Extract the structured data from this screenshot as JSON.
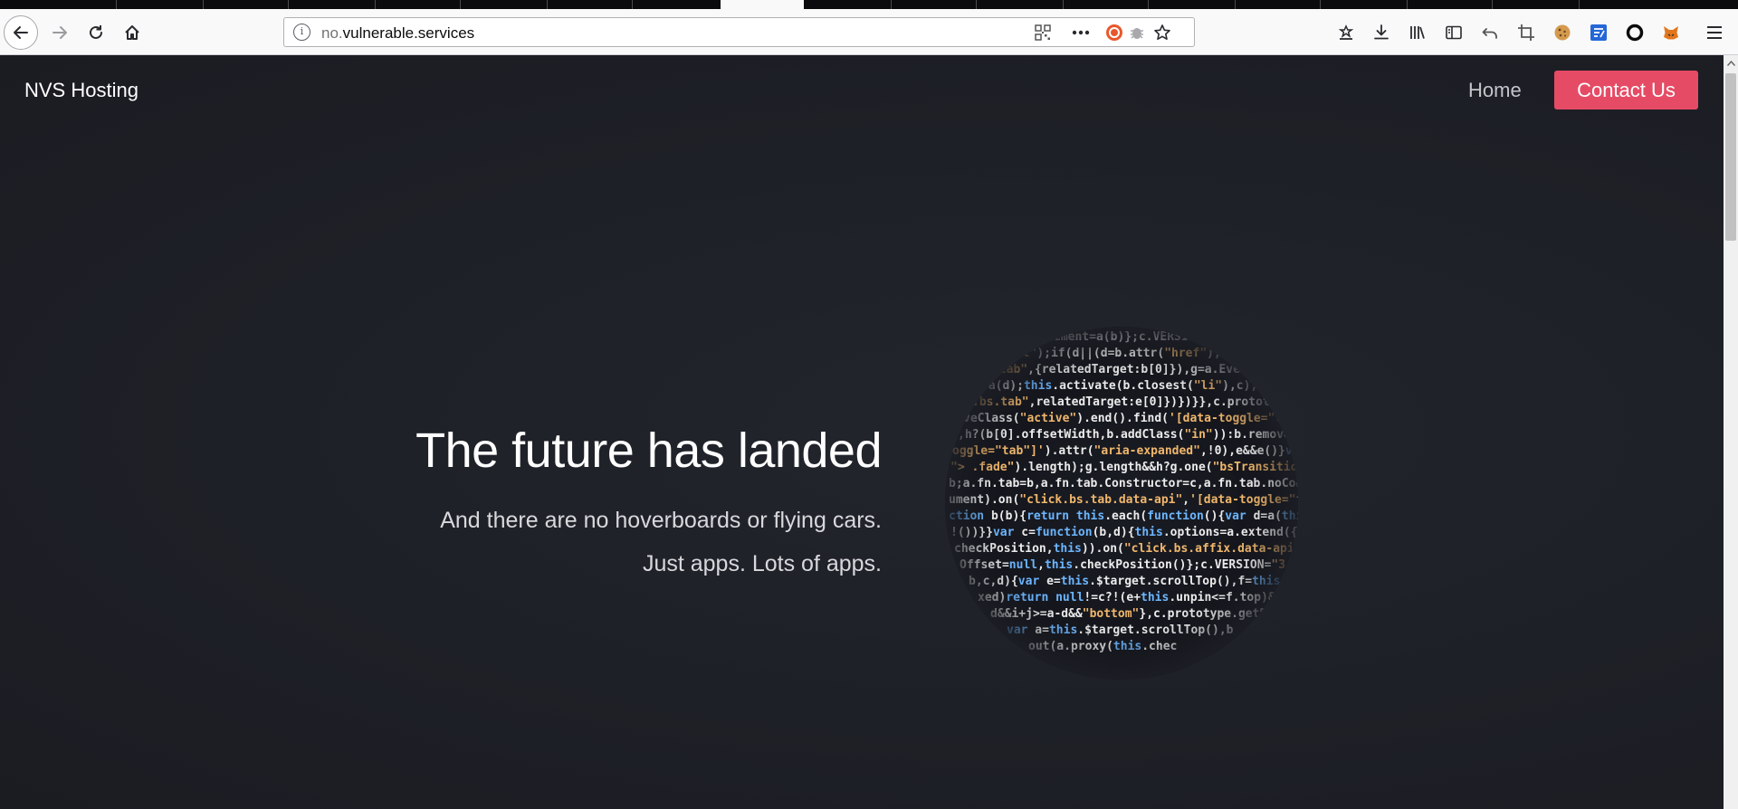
{
  "browser": {
    "url_prefix": "no.",
    "url_domain": "vulnerable.services",
    "icons": {
      "back": "back-arrow-icon",
      "forward": "forward-arrow-icon",
      "reload": "reload-icon",
      "home": "home-icon",
      "site_info": "info-icon",
      "qr": "qr-code-icon",
      "page_actions": "more-dots-icon",
      "ublock": "ublock-icon",
      "bug": "bug-icon",
      "bookmark": "star-icon",
      "pocket": "save-to-pocket-icon",
      "downloads": "download-icon",
      "library": "library-icon",
      "sidebar": "sidebar-icon",
      "undo": "undo-icon",
      "crop": "crop-icon",
      "cookie": "cookie-icon",
      "notes": "notes-icon",
      "circle_ext": "ring-icon",
      "metamask": "fox-icon",
      "menu": "hamburger-menu-icon"
    },
    "info_glyph": "i"
  },
  "site": {
    "brand": "NVS Hosting",
    "nav": {
      "home": "Home",
      "contact": "Contact Us"
    },
    "hero": {
      "title": "The future has landed",
      "subtitle_1": "And there are no hoverboards or flying cars.",
      "subtitle_2": "Just apps. Lots of apps."
    }
  },
  "colors": {
    "page_background": "#1e2027",
    "accent": "#e64b65"
  }
}
